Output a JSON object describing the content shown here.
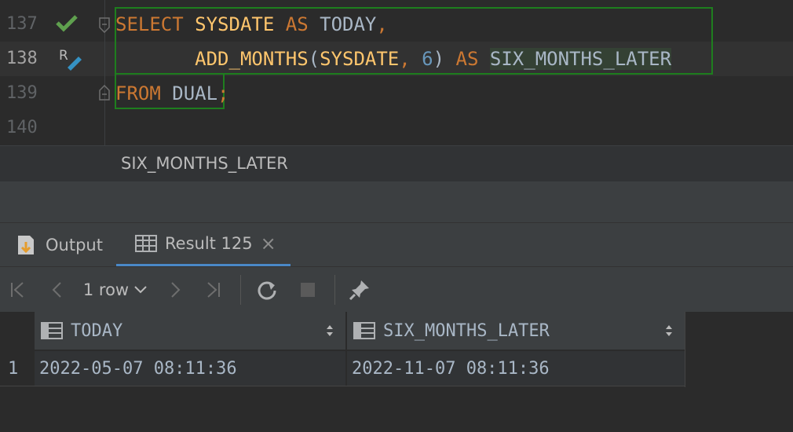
{
  "editor": {
    "line_numbers": [
      "137",
      "138",
      "139",
      "140"
    ],
    "line1": {
      "kw1": "SELECT",
      "fn1": "SYSDATE",
      "kw2": "AS",
      "id1": "TODAY",
      "punct": ","
    },
    "line2": {
      "fn1": "ADD_MONTHS",
      "p1": "(",
      "fn2": "SYSDATE",
      "p2": ",",
      "num": "6",
      "p3": ")",
      "kw1": "AS",
      "id1": "SIX_MONTHS_LATER"
    },
    "line3": {
      "kw1": "FROM",
      "id1": "DUAL",
      "punct": ";"
    },
    "gutter_icons": [
      "checkmark-icon",
      "run-edit-icon"
    ]
  },
  "breadcrumb": {
    "text": "SIX_MONTHS_LATER"
  },
  "tool_window": {
    "tabs": [
      {
        "label": "Output",
        "icon": "output-icon"
      },
      {
        "label": "Result 125",
        "icon": "table-icon",
        "close": "×"
      }
    ]
  },
  "toolbar": {
    "row_count": "1 row",
    "icons": [
      "first-page-icon",
      "previous-page-icon",
      "next-page-icon",
      "last-page-icon",
      "refresh-icon",
      "stop-icon",
      "pin-icon"
    ]
  },
  "grid": {
    "columns": [
      "TODAY",
      "SIX_MONTHS_LATER"
    ],
    "rows": [
      {
        "num": "1",
        "cells": [
          "2022-05-07 08:11:36",
          "2022-11-07 08:11:36"
        ]
      }
    ]
  },
  "colors": {
    "keyword": "#cc7832",
    "function": "#ffc66d",
    "number": "#6897bb",
    "identifier": "#a9b7c6",
    "highlight_box": "#1e7e1e"
  }
}
